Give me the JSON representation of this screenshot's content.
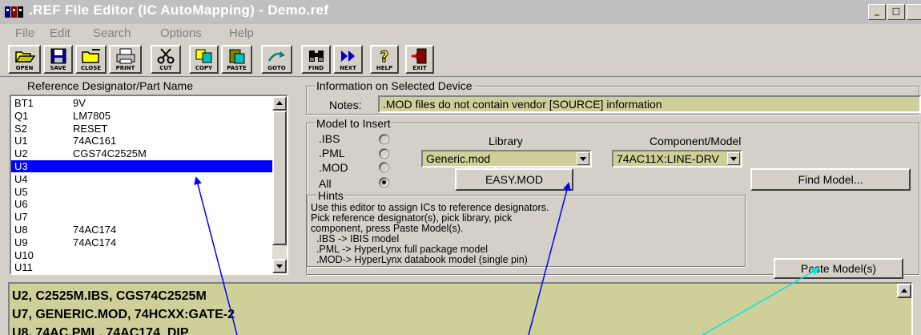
{
  "window": {
    "title": ".REF File Editor (IC AutoMapping) - Demo.ref",
    "minimize_label": "_",
    "maximize_label": "□"
  },
  "menu": [
    "File",
    "Edit",
    "Search",
    "Options",
    "Help"
  ],
  "toolbar": [
    {
      "label": "OPEN",
      "icon": "folder-open-icon"
    },
    {
      "label": "SAVE",
      "icon": "floppy-icon"
    },
    {
      "label": "CLOSE",
      "icon": "folder-close-icon"
    },
    {
      "label": "PRINT",
      "icon": "printer-icon"
    },
    {
      "label": "CUT",
      "icon": "scissors-icon"
    },
    {
      "label": "COPY",
      "icon": "copy-icon"
    },
    {
      "label": "PASTE",
      "icon": "paste-icon"
    },
    {
      "label": "GOTO",
      "icon": "goto-icon"
    },
    {
      "label": "FIND",
      "icon": "binoculars-icon"
    },
    {
      "label": "NEXT",
      "icon": "next-icon"
    },
    {
      "label": "HELP",
      "icon": "question-icon"
    },
    {
      "label": "EXIT",
      "icon": "exit-door-icon"
    }
  ],
  "ref_list": {
    "header": "Reference Designator/Part Name",
    "items": [
      {
        "designator": "BT1",
        "part": "9V",
        "selected": false
      },
      {
        "designator": "Q1",
        "part": "LM7805",
        "selected": false
      },
      {
        "designator": "S2",
        "part": "RESET",
        "selected": false
      },
      {
        "designator": "U1",
        "part": "74AC161",
        "selected": false
      },
      {
        "designator": "U2",
        "part": "CGS74C2525M",
        "selected": false
      },
      {
        "designator": "U3",
        "part": "",
        "selected": true
      },
      {
        "designator": "U4",
        "part": "",
        "selected": false
      },
      {
        "designator": "U5",
        "part": "",
        "selected": false
      },
      {
        "designator": "U6",
        "part": "",
        "selected": false
      },
      {
        "designator": "U7",
        "part": "",
        "selected": false
      },
      {
        "designator": "U8",
        "part": "74AC174",
        "selected": false
      },
      {
        "designator": "U9",
        "part": "74AC174",
        "selected": false
      },
      {
        "designator": "U10",
        "part": "",
        "selected": false
      },
      {
        "designator": "U11",
        "part": "",
        "selected": false
      }
    ]
  },
  "device_info": {
    "group_label": "Information on Selected Device",
    "notes_label": "Notes:",
    "notes_value": ".MOD files do not contain vendor [SOURCE] information"
  },
  "model_insert": {
    "group_label": "Model to Insert",
    "radios": [
      {
        "label": ".IBS",
        "checked": false
      },
      {
        "label": ".PML",
        "checked": false
      },
      {
        "label": ".MOD",
        "checked": false
      },
      {
        "label": "All",
        "checked": true
      }
    ],
    "library_label": "Library",
    "library_value": "Generic.mod",
    "component_label": "Component/Model",
    "component_value": "74AC11X:LINE-DRV",
    "easy_mod_button": "EASY.MOD",
    "find_model_button": "Find Model...",
    "paste_model_button": "Paste Model(s)"
  },
  "hints": {
    "group_label": "Hints",
    "lines": [
      "Use this editor to assign ICs to reference designators.",
      "Pick reference designator(s), pick library, pick",
      "component, press Paste Model(s).",
      "  .IBS -> IBIS model",
      "  .PML -> HyperLynx full package model",
      "  .MOD-> HyperLynx databook model (single pin)"
    ]
  },
  "output": {
    "lines": [
      "U2, C2525M.IBS, CGS74C2525M",
      "U7, GENERIC.MOD, 74HCXX:GATE-2",
      "U8, 74AC.PML, 74AC174_DIP"
    ]
  },
  "colors": {
    "field_bg": "#cfcf9a",
    "selection": "#0000ff",
    "arrow_blue": "#0000ff",
    "arrow_cyan": "#00e5e5"
  }
}
